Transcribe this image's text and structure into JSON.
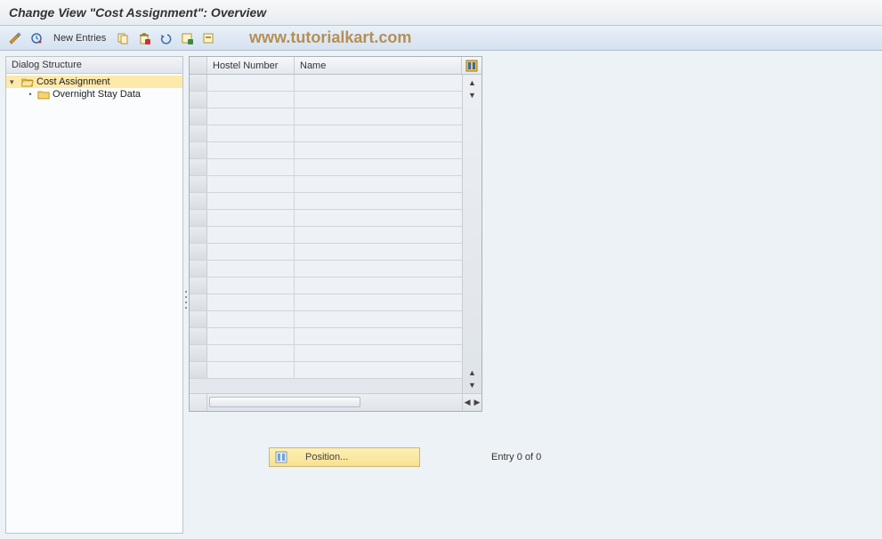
{
  "title": "Change View \"Cost Assignment\": Overview",
  "toolbar": {
    "new_entries_label": "New Entries"
  },
  "watermark": "www.tutorialkart.com",
  "tree": {
    "header": "Dialog Structure",
    "root": {
      "label": "Cost Assignment",
      "expanded": true
    },
    "child": {
      "label": "Overnight Stay Data"
    }
  },
  "grid": {
    "col1": "Hostel Number",
    "col2": "Name",
    "row_count": 18
  },
  "position_button": "Position...",
  "entry_status": "Entry 0 of 0"
}
